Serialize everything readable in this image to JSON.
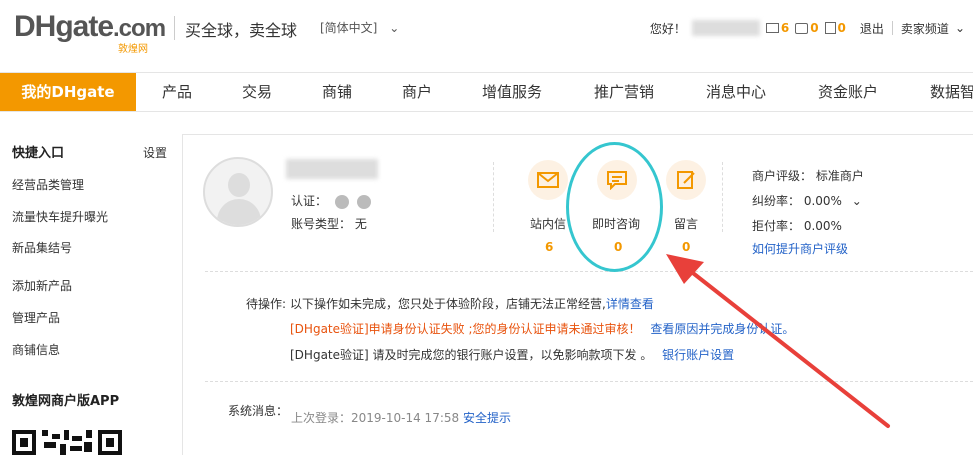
{
  "header": {
    "logo_main": "DHgate",
    "logo_com": ".com",
    "logo_sub": "敦煌网",
    "slogan": "买全球，卖全球",
    "language": "[简体中文]",
    "hello": "您好！",
    "mail_count": "6",
    "chat_count": "0",
    "note_count": "0",
    "logout": "退出",
    "seller_channel": "卖家频道"
  },
  "nav": {
    "home": "我的DHgate",
    "items": [
      "产品",
      "交易",
      "商铺",
      "商户",
      "增值服务",
      "推广营销",
      "消息中心",
      "资金账户",
      "数据智"
    ]
  },
  "sidebar": {
    "quick_title": "快捷入口",
    "settings": "设置",
    "items": [
      "经营品类管理",
      "流量快车提升曝光",
      "新品集结号",
      "添加新产品",
      "管理产品",
      "商铺信息"
    ],
    "app_title": "敦煌网商户版APP"
  },
  "profile": {
    "verify_label": "认证：",
    "account_type": "账号类型： 无"
  },
  "messages": [
    {
      "label": "站内信",
      "count": "6"
    },
    {
      "label": "即时咨询",
      "count": "0"
    },
    {
      "label": "留言",
      "count": "0"
    }
  ],
  "merchant": {
    "rating": "商户评级： 标准商户",
    "dispute": "纠纷率： 0.00%",
    "refuse": "拒付率： 0.00%",
    "improve_link": "如何提升商户评级"
  },
  "pending": {
    "label": "待操作:",
    "line1": "以下操作如未完成，您只处于体验阶段，店铺无法正常经营,",
    "line1_link": "详情查看",
    "line2_warn": "[DHgate验证]申请身份认证失败 ;您的身份认证申请未通过审核！",
    "line2_link": "查看原因并完成身份认证。",
    "line3": "[DHgate验证] 请及时完成您的银行账户设置，以免影响款项下发 。",
    "line3_link": "银行账户设置"
  },
  "system": {
    "label": "系统消息：",
    "last_login": "上次登录：2019-10-14 17:58",
    "security_link": "安全提示"
  },
  "colors": {
    "brand_orange": "#f39800",
    "link_blue": "#2463c8",
    "warn_orange": "#e8530e",
    "annotation_cyan": "#35c6cf",
    "annotation_red": "#e8403a"
  }
}
